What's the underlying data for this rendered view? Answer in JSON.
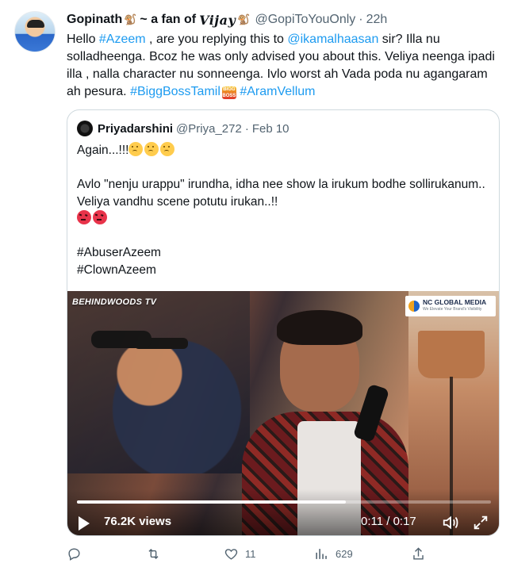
{
  "tweet": {
    "author_name": "Gopinath",
    "name_part2": "~ a fan of",
    "name_styled": "Vijay",
    "name_glyph": "🐒",
    "handle": "@GopiToYouOnly",
    "dot": "·",
    "time": "22h",
    "text": {
      "t1": "Hello ",
      "mention_tag": "#Azeem",
      "t2": " , are you replying this to ",
      "mention_user": "@ikamalhaasan",
      "t3": " sir? Illa nu solladheenga. Bcoz he was only advised you about this. Veliya neenga ipadi illa , nalla character nu sonneenga. Ivlo worst ah Vada poda nu agangaram ah pesura. ",
      "hashtag1": "#BiggBossTamil",
      "badge_text": "BIGG BOSS",
      "t4": " ",
      "hashtag2": "#AramVellum"
    }
  },
  "quote": {
    "name": "Priyadarshini",
    "handle": "@Priya_272",
    "dot": "·",
    "date": "Feb 10",
    "line1": "Again...!!!",
    "line2": "Avlo \"nenju urappu\" irundha, idha nee show la irukum bodhe sollirukanum.. Veliya vandhu scene potutu irukan..!!",
    "hashtag1": "#AbuserAzeem",
    "hashtag2": "#ClownAzeem"
  },
  "video": {
    "watermark": "BEHINDWOODS TV",
    "badge_title": "NC GLOBAL MEDIA",
    "badge_sub": "We Elevate Your Brand's Visibility",
    "views": "76.2K views",
    "time_readout": "0:11 / 0:17",
    "progress": 0.65
  },
  "actions": {
    "reply_count": "",
    "retweet_count": "",
    "like_count": "11",
    "views_count": "629"
  },
  "colors": {
    "link": "#1d9bf0",
    "secondary_text": "#536471",
    "border": "#cfd9de"
  }
}
